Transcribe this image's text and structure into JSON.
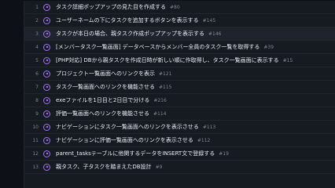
{
  "rows": [
    {
      "num": "1",
      "title": "タスク詳細ポップアップの見た目を作成する",
      "issue": "#80"
    },
    {
      "num": "2",
      "title": "ユーザーネームの下にタスクを追加するボタンを表示する",
      "issue": "#145"
    },
    {
      "num": "3",
      "title": "タスクが本日の場合、親タスク作成ポップアップを表示する",
      "issue": "#146"
    },
    {
      "num": "4",
      "title": "[メンバータスク一覧画面] データベースからメンバー全員のタスク一覧を取得する",
      "issue": "#39"
    },
    {
      "num": "5",
      "title": "[PHP対応] DBから親タスクを作成日時が新しい順に作取得し、タスク一覧画面に表示する",
      "issue": "#15"
    },
    {
      "num": "6",
      "title": "プロジェクト一覧画面へのリンクを表示",
      "issue": "#121"
    },
    {
      "num": "7",
      "title": "タスク一覧画面へのリンクを機能させる",
      "issue": "#115"
    },
    {
      "num": "8",
      "title": "exeファイルを1日目と2日目で分ける",
      "issue": "#216"
    },
    {
      "num": "9",
      "title": "評価一覧画面へのリンクを機能させる",
      "issue": "#114"
    },
    {
      "num": "10",
      "title": "ナビゲーションにタスク一覧画面へのリンクを表示させる",
      "issue": "#113"
    },
    {
      "num": "11",
      "title": "ナビゲーションに評価一覧画面へのリンクを表示させる",
      "issue": "#112"
    },
    {
      "num": "12",
      "title": "parent_tasksテーブルに他関するデータをINSERT文で登録する",
      "issue": "#19"
    },
    {
      "num": "13",
      "title": "親タスク、子タスクを踏まえたDB設計",
      "issue": "#9"
    }
  ],
  "colors": {
    "status_open": "#a371f7",
    "text": "#e6edf3",
    "muted": "#7d8590"
  },
  "icons": {
    "grip": "drag-handle-icon",
    "status": "issue-open-icon"
  }
}
